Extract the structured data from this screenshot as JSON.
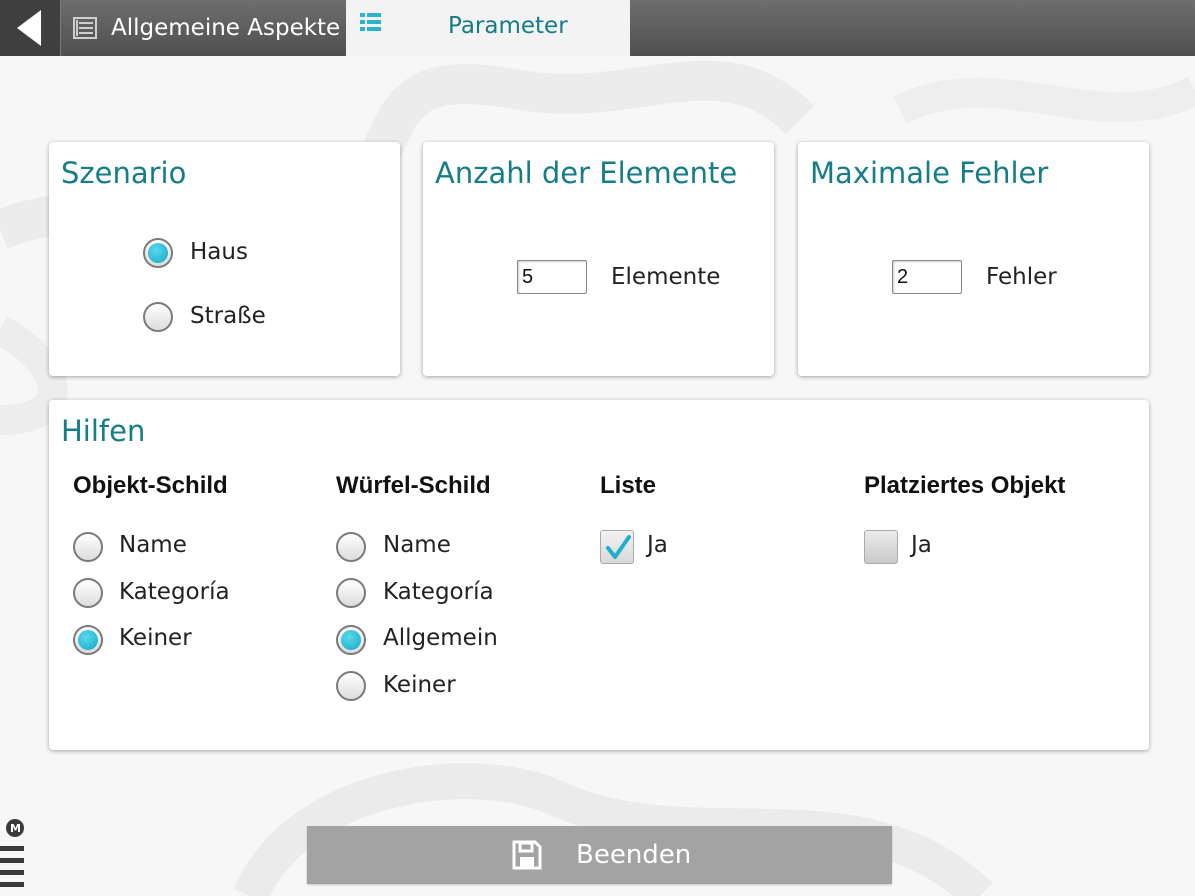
{
  "header": {
    "tabs": [
      {
        "label": "Allgemeine Aspekte"
      },
      {
        "label": "Parameter"
      }
    ]
  },
  "scenario": {
    "title": "Szenario",
    "options": [
      {
        "label": "Haus",
        "selected": true
      },
      {
        "label": "Straße",
        "selected": false
      }
    ]
  },
  "elements": {
    "title": "Anzahl der Elemente",
    "value": "5",
    "unit": "Elemente"
  },
  "errors": {
    "title": "Maximale Fehler",
    "value": "2",
    "unit": "Fehler"
  },
  "help": {
    "title": "Hilfen",
    "object_sign": {
      "heading": "Objekt-Schild",
      "options": [
        {
          "label": "Name",
          "selected": false
        },
        {
          "label": "Kategoría",
          "selected": false
        },
        {
          "label": "Keiner",
          "selected": true
        }
      ]
    },
    "dice_sign": {
      "heading": "Würfel-Schild",
      "options": [
        {
          "label": "Name",
          "selected": false
        },
        {
          "label": "Kategoría",
          "selected": false
        },
        {
          "label": "Allgemein",
          "selected": true
        },
        {
          "label": "Keiner",
          "selected": false
        }
      ]
    },
    "list": {
      "heading": "Liste",
      "checkbox_label": "Ja",
      "checked": true
    },
    "placed_object": {
      "heading": "Platziertes Objekt",
      "checkbox_label": "Ja",
      "checked": false
    }
  },
  "footer": {
    "finish_label": "Beenden"
  },
  "colors": {
    "accent": "#157d88",
    "radio_selected": "#12a9c6",
    "topbar": "#5a5a5a",
    "button": "#a3a3a3"
  },
  "icons": [
    "back-arrow-icon",
    "list-icon",
    "parameter-list-icon",
    "save-icon",
    "logo-icon"
  ]
}
